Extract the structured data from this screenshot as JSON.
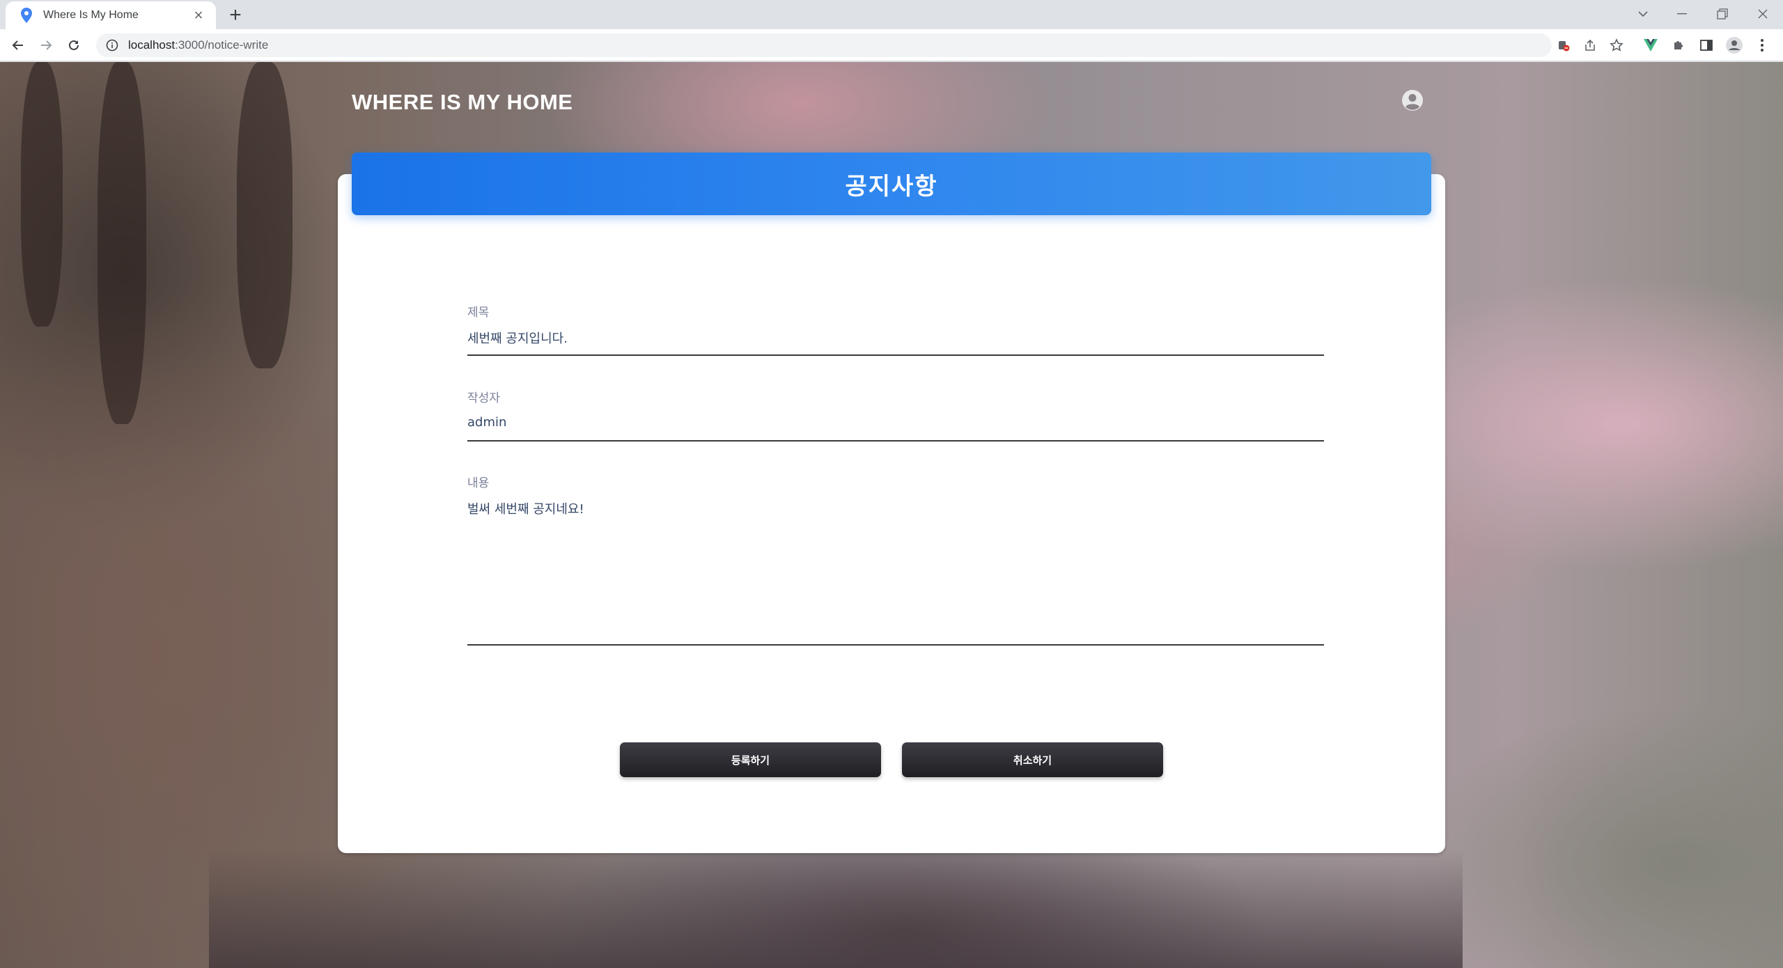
{
  "browser": {
    "tab_title": "Where Is My Home",
    "url_host": "localhost",
    "url_path": ":3000/notice-write",
    "new_tab_label": "+",
    "close_tab_label": "×"
  },
  "header": {
    "brand": "WHERE IS MY HOME"
  },
  "notice_form": {
    "title": "공지사항",
    "subject_label": "제목",
    "subject_value": "세번째 공지입니다.",
    "author_label": "작성자",
    "author_value": "admin",
    "content_label": "내용",
    "content_value": "벌써 세번째 공지네요!",
    "submit_label": "등록하기",
    "cancel_label": "취소하기"
  },
  "colors": {
    "header_gradient_start": "#1a73e8",
    "header_gradient_end": "#4298ea",
    "button_dark": "#1f1f23"
  }
}
